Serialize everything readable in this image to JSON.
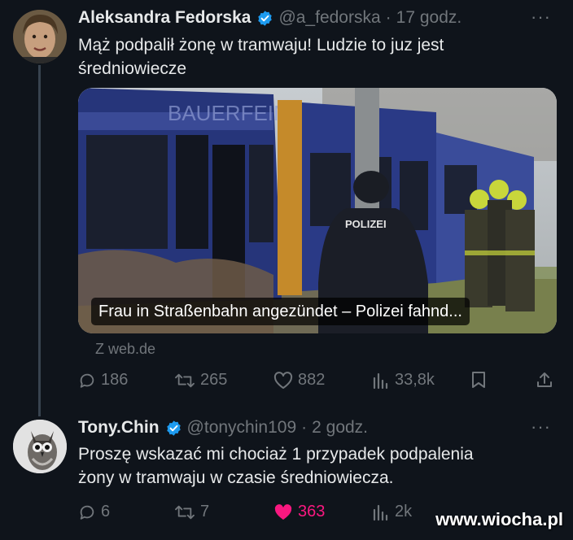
{
  "tweet1": {
    "name": "Aleksandra Fedorska",
    "handle": "@a_fedorska",
    "dot": "·",
    "time": "17 godz.",
    "text_line1": "Mąż podpalił żonę w tramwaju! Ludzie to juz jest",
    "text_line2": "średniowiecze",
    "card": {
      "caption": "Frau in Straßenbahn angezündet – Polizei fahnd...",
      "tram_lettering": "BAUERFEIND",
      "vest_lettering": "POLIZEI",
      "source": "Z web.de"
    },
    "stats": {
      "replies": "186",
      "retweets": "265",
      "likes": "882",
      "views": "33,8k"
    }
  },
  "tweet2": {
    "name": "Tony.Chin",
    "handle": "@tonychin109",
    "dot": "·",
    "time": "2 godz.",
    "text_line1": "Proszę wskazać mi chociaż 1 przypadek podpalenia",
    "text_line2": "żony w tramwaju w czasie średniowiecza.",
    "stats": {
      "replies": "6",
      "retweets": "7",
      "likes": "363",
      "views": "2k"
    }
  },
  "more_icon": "···",
  "watermark": "www.wiocha.pl",
  "colors": {
    "background": "#0f141b",
    "text": "#e7e9ea",
    "muted": "#71767b",
    "verified": "#1d9bf0",
    "like_active": "#f91880"
  }
}
